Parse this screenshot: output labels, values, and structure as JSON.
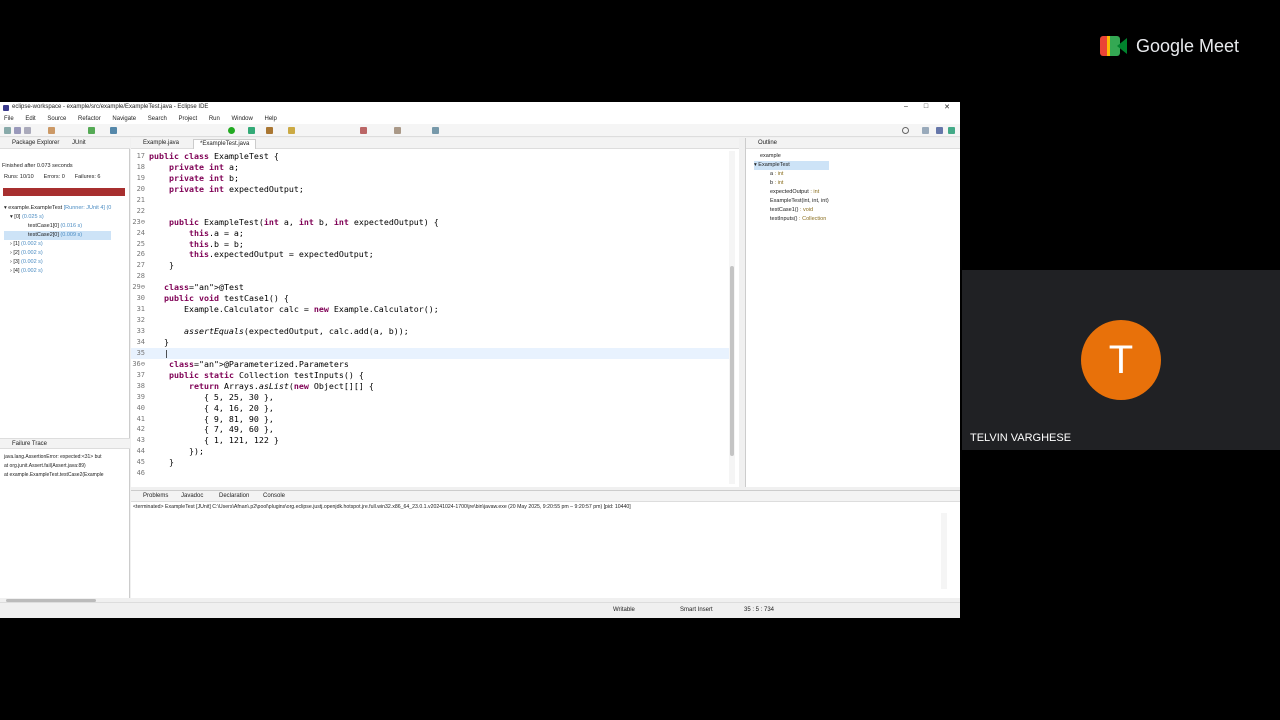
{
  "meet": {
    "brand": "Google Meet",
    "participant_initial": "T",
    "participant_name": "TELVIN VARGHESE",
    "avatar_color": "#e8710a"
  },
  "eclipse": {
    "title": "eclipse-workspace - example/src/example/ExampleTest.java - Eclipse IDE",
    "menu": [
      "File",
      "Edit",
      "Source",
      "Refactor",
      "Navigate",
      "Search",
      "Project",
      "Run",
      "Window",
      "Help"
    ],
    "window_buttons": [
      "–",
      "□",
      "✕"
    ],
    "left_tabs": [
      "Package Explorer",
      "JUnit"
    ],
    "junit": {
      "finished": "Finished after 0.073 seconds",
      "runs": "Runs: 10/10",
      "errors": "Errors: 0",
      "failures": "Failures: 6",
      "bar_color": "#a72f2f",
      "tree": [
        {
          "label": "example.ExampleTest",
          "detail": "[Runner: JUnit 4] (0"
        },
        {
          "label": "[0]",
          "detail": "(0.025 s)"
        },
        {
          "label": "testCase1[0]",
          "detail": "(0.016 s)"
        },
        {
          "label": "testCase2[0]",
          "detail": "(0.009 s)"
        },
        {
          "label": "[1]",
          "detail": "(0.002 s)"
        },
        {
          "label": "[2]",
          "detail": "(0.002 s)"
        },
        {
          "label": "[3]",
          "detail": "(0.002 s)"
        },
        {
          "label": "[4]",
          "detail": "(0.002 s)"
        }
      ]
    },
    "failure_trace": {
      "title": "Failure Trace",
      "lines": [
        "java.lang.AssertionError: expected:<31> but",
        "at org.junit.Assert.fail(Assert.java:89)",
        "at example.ExampleTest.testCase2(Example"
      ]
    },
    "editor_tabs": [
      "Example.java",
      "*ExampleTest.java"
    ],
    "code_lines": [
      {
        "n": "17",
        "t": "public class ExampleTest {"
      },
      {
        "n": "18",
        "t": "    private int a;"
      },
      {
        "n": "19",
        "t": "    private int b;"
      },
      {
        "n": "20",
        "t": "    private int expectedOutput;"
      },
      {
        "n": "21",
        "t": ""
      },
      {
        "n": "22",
        "t": ""
      },
      {
        "n": "23⊖",
        "t": "    public ExampleTest(int a, int b, int expectedOutput) {"
      },
      {
        "n": "24",
        "t": "        this.a = a;"
      },
      {
        "n": "25",
        "t": "        this.b = b;"
      },
      {
        "n": "26",
        "t": "        this.expectedOutput = expectedOutput;"
      },
      {
        "n": "27",
        "t": "    }"
      },
      {
        "n": "28",
        "t": ""
      },
      {
        "n": "29⊖",
        "t": "   @Test"
      },
      {
        "n": "30",
        "t": "   public void testCase1() {"
      },
      {
        "n": "31",
        "t": "       Example.Calculator calc = new Example.Calculator();"
      },
      {
        "n": "32",
        "t": ""
      },
      {
        "n": "33",
        "t": "       assertEquals(expectedOutput, calc.add(a, b));"
      },
      {
        "n": "34",
        "t": "   }"
      },
      {
        "n": "35",
        "t": "   |"
      },
      {
        "n": "36⊖",
        "t": "    @Parameterized.Parameters"
      },
      {
        "n": "37",
        "t": "    public static Collection testInputs() {"
      },
      {
        "n": "38",
        "t": "        return Arrays.asList(new Object[][] {"
      },
      {
        "n": "39",
        "t": "           { 5, 25, 30 },"
      },
      {
        "n": "40",
        "t": "           { 4, 16, 20 },"
      },
      {
        "n": "41",
        "t": "           { 9, 81, 90 },"
      },
      {
        "n": "42",
        "t": "           { 7, 49, 60 },"
      },
      {
        "n": "43",
        "t": "           { 1, 121, 122 }"
      },
      {
        "n": "44",
        "t": "        });"
      },
      {
        "n": "45",
        "t": "    }"
      },
      {
        "n": "46",
        "t": ""
      }
    ],
    "outline": {
      "title": "Outline",
      "items": [
        {
          "label": "example",
          "type": ""
        },
        {
          "label": "ExampleTest",
          "type": ""
        },
        {
          "label": "a",
          "type": ": int"
        },
        {
          "label": "b",
          "type": ": int"
        },
        {
          "label": "expectedOutput",
          "type": ": int"
        },
        {
          "label": "ExampleTest(int, int, int)",
          "type": ""
        },
        {
          "label": "testCase1()",
          "type": ": void"
        },
        {
          "label": "testInputs()",
          "type": ": Collection"
        }
      ]
    },
    "console_tabs": [
      "Problems",
      "Javadoc",
      "Declaration",
      "Console"
    ],
    "console_line": "<terminated> ExampleTest [JUnit] C:\\Users\\Afnan\\.p2\\pool\\plugins\\org.eclipse.justj.openjdk.hotspot.jre.full.win32.x86_64_23.0.1.v20241024-1700\\jre\\bin\\javaw.exe  (20 May 2025, 9:20:55 pm – 9:20:57 pm) [pid: 10440]",
    "status": {
      "writable": "Writable",
      "insert": "Smart Insert",
      "position": "35 : 5 : 734"
    }
  }
}
